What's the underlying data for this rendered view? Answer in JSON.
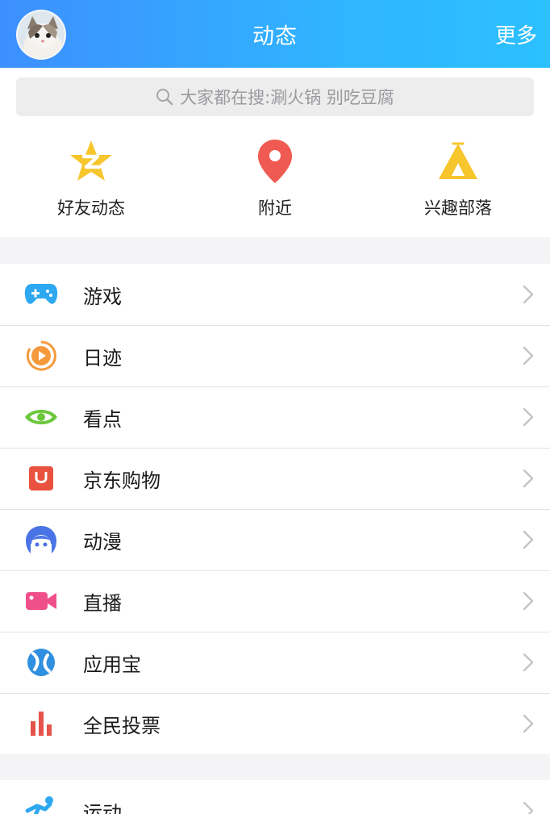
{
  "header": {
    "title": "动态",
    "more_label": "更多"
  },
  "search": {
    "placeholder": "大家都在搜:涮火锅 别吃豆腐"
  },
  "quick": [
    {
      "label": "好友动态",
      "icon": "qzone-star-icon"
    },
    {
      "label": "附近",
      "icon": "location-pin-icon"
    },
    {
      "label": "兴趣部落",
      "icon": "tent-icon"
    }
  ],
  "list": [
    {
      "label": "游戏",
      "icon": "gamepad-icon",
      "color": "#2ea8f0"
    },
    {
      "label": "日迹",
      "icon": "play-circle-icon",
      "color": "#f59a3c"
    },
    {
      "label": "看点",
      "icon": "eye-icon",
      "color": "#6cc73a"
    },
    {
      "label": "京东购物",
      "icon": "shopping-bag-icon",
      "color": "#e8523e"
    },
    {
      "label": "动漫",
      "icon": "anime-face-icon",
      "color": "#4a74e6"
    },
    {
      "label": "直播",
      "icon": "video-camera-icon",
      "color": "#f0508a"
    },
    {
      "label": "应用宝",
      "icon": "app-store-icon",
      "color": "#2f8fe0"
    },
    {
      "label": "全民投票",
      "icon": "bar-chart-icon",
      "color": "#e5524a"
    }
  ],
  "list2": [
    {
      "label": "运动",
      "icon": "running-icon",
      "color": "#2ea8f0"
    }
  ]
}
